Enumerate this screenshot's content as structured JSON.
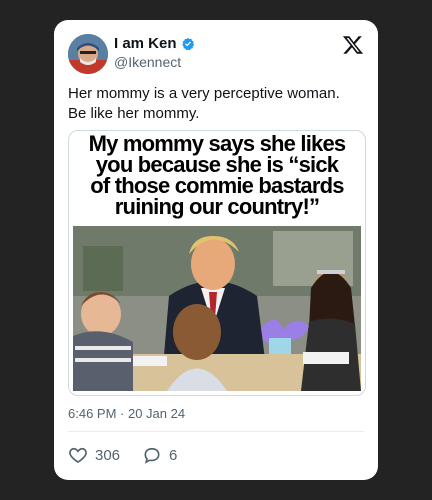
{
  "tweet": {
    "author": {
      "display_name": "I am Ken",
      "handle": "@Ikennect",
      "verified": true
    },
    "text_line1": "Her mommy is a very perceptive woman.",
    "text_line2": "Be like her mommy.",
    "media": {
      "caption_line1": "My mommy says she likes",
      "caption_line2": "you because she is “sick",
      "caption_line3": "of those commie bastards",
      "caption_line4": "ruining our country!”"
    },
    "timestamp": "6:46 PM · 20 Jan 24",
    "likes": "306",
    "replies": "6"
  },
  "icons": {
    "brand": "x-logo-icon",
    "verified": "verified-badge-icon",
    "like": "heart-icon",
    "reply": "reply-bubble-icon"
  },
  "colors": {
    "verified": "#1d9bf0",
    "secondary_text": "#536471",
    "background": "#232323",
    "card": "#ffffff"
  }
}
